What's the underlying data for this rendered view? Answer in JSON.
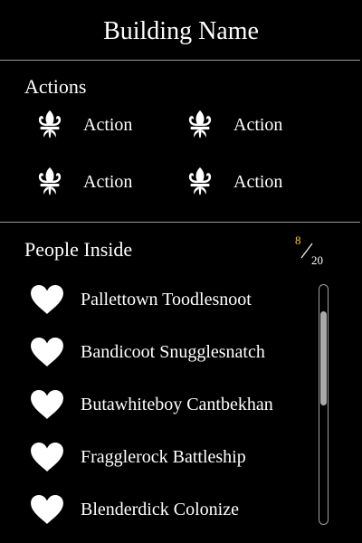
{
  "header": {
    "title": "Building Name"
  },
  "actions": {
    "heading": "Actions",
    "items": [
      {
        "label": "Action",
        "icon": "fleur-de-lis-icon"
      },
      {
        "label": "Action",
        "icon": "fleur-de-lis-icon"
      },
      {
        "label": "Action",
        "icon": "fleur-de-lis-icon"
      },
      {
        "label": "Action",
        "icon": "fleur-de-lis-icon"
      }
    ]
  },
  "people": {
    "heading": "People Inside",
    "count": "8",
    "capacity": "20",
    "list": [
      {
        "name": "Pallettown Toodlesnoot",
        "icon": "heart-icon"
      },
      {
        "name": "Bandicoot Snugglesnatch",
        "icon": "heart-icon"
      },
      {
        "name": "Butawhiteboy Cantbekhan",
        "icon": "heart-icon"
      },
      {
        "name": "Fragglerock Battleship",
        "icon": "heart-icon"
      },
      {
        "name": "Blenderdick Colonize",
        "icon": "heart-icon"
      }
    ]
  },
  "colors": {
    "background": "#000000",
    "text": "#ffffff",
    "count_accent": "#f2c94c",
    "divider": "#9a9a9a",
    "scrollbar": "#a9a9a9"
  }
}
